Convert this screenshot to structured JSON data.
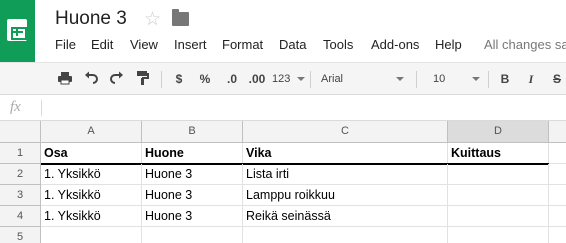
{
  "document": {
    "title": "Huone 3",
    "status": "All changes saved"
  },
  "icons": {
    "logo": "sheets-logo-icon",
    "star": "star-icon",
    "folder": "folder-icon"
  },
  "menu": [
    "File",
    "Edit",
    "View",
    "Insert",
    "Format",
    "Data",
    "Tools",
    "Add-ons",
    "Help"
  ],
  "toolbar": {
    "currency": "$",
    "percent": "%",
    "decrease_decimals": ".0",
    "increase_decimals": ".00",
    "more_formats": "123",
    "font": "Arial",
    "font_size": "10",
    "bold": "B",
    "italic": "I",
    "strike": "S"
  },
  "formula_bar": {
    "label": "fx",
    "value": ""
  },
  "grid": {
    "columns": [
      "A",
      "B",
      "C",
      "D"
    ],
    "rows": [
      {
        "number": "1",
        "cells": [
          "Osa",
          "Huone",
          "Vika",
          "Kuittaus"
        ]
      },
      {
        "number": "2",
        "cells": [
          "1. Yksikkö",
          "Huone 3",
          "Lista irti",
          ""
        ]
      },
      {
        "number": "3",
        "cells": [
          "1. Yksikkö",
          "Huone 3",
          "Lamppu roikkuu",
          ""
        ]
      },
      {
        "number": "4",
        "cells": [
          "1. Yksikkö",
          "Huone 3",
          "Reikä seinässä",
          ""
        ]
      },
      {
        "number": "5",
        "cells": [
          "",
          "",
          "",
          ""
        ]
      }
    ],
    "selected_column": "D",
    "colors": {
      "accent": "#0f9d58",
      "header_bg": "#f3f3f3",
      "selected_header_bg": "#dcdcdc"
    }
  }
}
